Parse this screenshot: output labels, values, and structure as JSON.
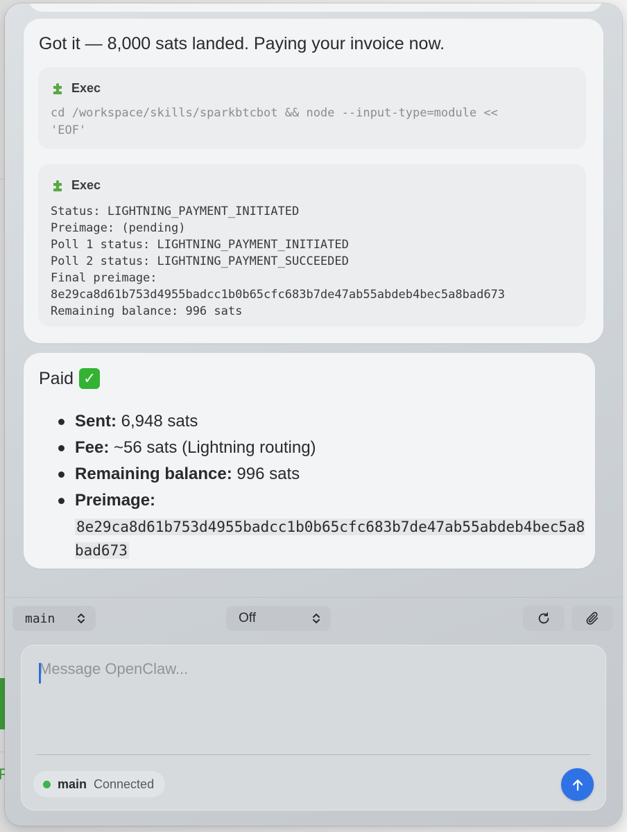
{
  "messages": [
    {
      "text": "Got it — 8,000 sats landed. Paying your invoice now.",
      "exec_blocks": [
        {
          "title": "Exec",
          "icon": "puzzle-icon",
          "content": "cd /workspace/skills/sparkbtcbot && node --input-type=module <<\n'EOF'"
        },
        {
          "title": "Exec",
          "icon": "puzzle-icon",
          "content": "Status: LIGHTNING_PAYMENT_INITIATED\nPreimage: (pending)\nPoll 1 status: LIGHTNING_PAYMENT_INITIATED\nPoll 2 status: LIGHTNING_PAYMENT_SUCCEEDED\nFinal preimage:\n8e29ca8d61b753d4955badcc1b0b65cfc683b7de47ab55abdeb4bec5a8bad673\nRemaining balance: 996 sats"
        }
      ]
    },
    {
      "title": "Paid",
      "title_icon": "check-mark-icon",
      "items": [
        {
          "label": "Sent:",
          "value": " 6,948 sats"
        },
        {
          "label": "Fee:",
          "value": " ~56 sats (Lightning routing)"
        },
        {
          "label": "Remaining balance:",
          "value": " 996 sats"
        },
        {
          "label": "Preimage:",
          "value": "8e29ca8d61b753d4955badcc1b0b65cfc683b7de47ab55abdeb4bec5a8bad673"
        }
      ]
    }
  ],
  "controls": {
    "session_select": "main",
    "thinking_select": "Off",
    "refresh_icon": "refresh-icon",
    "attach_icon": "paperclip-icon"
  },
  "composer": {
    "placeholder": "Message OpenClaw...",
    "value": ""
  },
  "status": {
    "session": "main",
    "connection": "Connected",
    "dot_color": "#3cb44b"
  },
  "colors": {
    "accent": "#2e72e6",
    "status_green": "#3cb44b",
    "check_green": "#34b233"
  }
}
